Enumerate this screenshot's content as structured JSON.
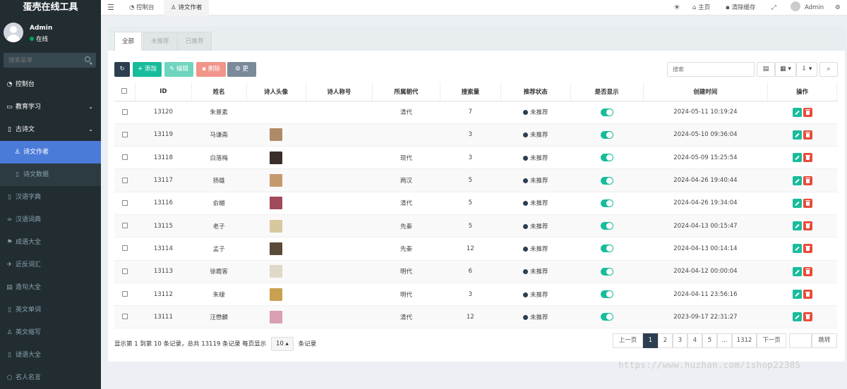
{
  "brand": "蛋壳在线工具",
  "user": {
    "name": "Admin",
    "status": "在线"
  },
  "sidebar_search_placeholder": "搜索菜单",
  "menu": [
    {
      "label": "控制台",
      "icon": "dashboard-icon",
      "icon_glyph": "◔",
      "kind": "top"
    },
    {
      "label": "教育学习",
      "icon": "monitor-icon",
      "icon_glyph": "▭",
      "kind": "top",
      "chevron": "⌄"
    },
    {
      "label": "古诗文",
      "icon": "file-icon",
      "icon_glyph": "▯",
      "kind": "top",
      "chevron": "⌄"
    },
    {
      "label": "诗文作者",
      "icon": "user-icon",
      "icon_glyph": "♙",
      "kind": "sub-active"
    },
    {
      "label": "诗文数据",
      "icon": "file-icon",
      "icon_glyph": "▯",
      "kind": "sub"
    },
    {
      "label": "汉语字典",
      "icon": "file-icon",
      "icon_glyph": "▯",
      "kind": "dim"
    },
    {
      "label": "汉语词典",
      "icon": "glasses-icon",
      "icon_glyph": "∞",
      "kind": "dim"
    },
    {
      "label": "成语大全",
      "icon": "flag-icon",
      "icon_glyph": "⚑",
      "kind": "dim"
    },
    {
      "label": "近反词汇",
      "icon": "plane-icon",
      "icon_glyph": "✈",
      "kind": "dim"
    },
    {
      "label": "造句大全",
      "icon": "doc-icon",
      "icon_glyph": "▤",
      "kind": "dim"
    },
    {
      "label": "英文单词",
      "icon": "file-icon",
      "icon_glyph": "▯",
      "kind": "dim"
    },
    {
      "label": "英文缩写",
      "icon": "user-icon",
      "icon_glyph": "♙",
      "kind": "dim"
    },
    {
      "label": "谜语大全",
      "icon": "file-icon",
      "icon_glyph": "▯",
      "kind": "dim"
    },
    {
      "label": "名人名言",
      "icon": "circle-icon",
      "icon_glyph": "○",
      "kind": "dim"
    }
  ],
  "header": {
    "tabs": [
      {
        "label": "控制台",
        "icon_glyph": "◔"
      },
      {
        "label": "诗文作者",
        "icon_glyph": "♙"
      }
    ],
    "home": "主页",
    "clear_cache": "清除缓存",
    "admin": "Admin"
  },
  "panel_tabs": [
    "全部",
    "未推荐",
    "已推荐"
  ],
  "toolbar": {
    "add": "添加",
    "edit": "编辑",
    "delete": "删除",
    "more": "更多",
    "search_placeholder": "搜索"
  },
  "table": {
    "columns": [
      "ID",
      "姓名",
      "诗人头像",
      "诗人称号",
      "所属朝代",
      "搜索量",
      "推荐状态",
      "是否显示",
      "创建时间",
      "操作"
    ],
    "rows": [
      {
        "id": "13120",
        "name": "朱景素",
        "avatar": "",
        "title": "",
        "dynasty": "清代",
        "searches": "7",
        "status": "未推荐",
        "created": "2024-05-11 10:19:24"
      },
      {
        "id": "13119",
        "name": "马谦斋",
        "avatar": "#b08a68",
        "title": "",
        "dynasty": "",
        "searches": "3",
        "status": "未推荐",
        "created": "2024-05-10 09:36:04"
      },
      {
        "id": "13118",
        "name": "白落梅",
        "avatar": "#3a2e2a",
        "title": "",
        "dynasty": "现代",
        "searches": "3",
        "status": "未推荐",
        "created": "2024-05-09 15:25:54"
      },
      {
        "id": "13117",
        "name": "扬雄",
        "avatar": "#c49a6c",
        "title": "",
        "dynasty": "两汉",
        "searches": "5",
        "status": "未推荐",
        "created": "2024-04-26 19:40:44"
      },
      {
        "id": "13116",
        "name": "俞樾",
        "avatar": "#a04a5a",
        "title": "",
        "dynasty": "清代",
        "searches": "5",
        "status": "未推荐",
        "created": "2024-04-26 19:34:04"
      },
      {
        "id": "13115",
        "name": "老子",
        "avatar": "#d8c8a0",
        "title": "",
        "dynasty": "先秦",
        "searches": "5",
        "status": "未推荐",
        "created": "2024-04-13 00:15:47"
      },
      {
        "id": "13114",
        "name": "孟子",
        "avatar": "#5a4a3a",
        "title": "",
        "dynasty": "先秦",
        "searches": "12",
        "status": "未推荐",
        "created": "2024-04-13 00:14:14"
      },
      {
        "id": "13113",
        "name": "徐霞客",
        "avatar": "#e0d8c8",
        "title": "",
        "dynasty": "明代",
        "searches": "6",
        "status": "未推荐",
        "created": "2024-04-12 00:00:04"
      },
      {
        "id": "13112",
        "name": "朱棣",
        "avatar": "#c8a050",
        "title": "",
        "dynasty": "明代",
        "searches": "3",
        "status": "未推荐",
        "created": "2024-04-11 23:56:16"
      },
      {
        "id": "13111",
        "name": "汪懋麟",
        "avatar": "#d8a0b0",
        "title": "",
        "dynasty": "清代",
        "searches": "12",
        "status": "未推荐",
        "created": "2023-09-17 22:31:27"
      }
    ]
  },
  "footer": {
    "info": "显示第 1 到第 10 条记录，总共 13119 条记录 每页显示",
    "page_size": "10",
    "page_size_suffix": "条记录",
    "prev": "上一页",
    "pages": [
      "1",
      "2",
      "3",
      "4",
      "5",
      "...",
      "1312"
    ],
    "next": "下一页",
    "jump": "跳转"
  },
  "watermark": "https://www.huzhan.com/ishop22385",
  "colors": {
    "sidebar": "#222d32",
    "active_menu": "#4b7bd8",
    "teal": "#18bc9c",
    "red": "#e74c3c",
    "navy": "#2c3e50"
  }
}
